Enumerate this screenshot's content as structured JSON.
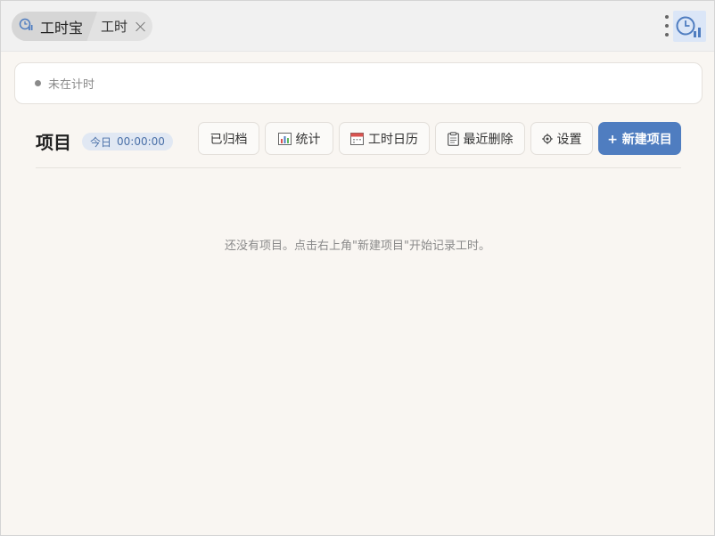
{
  "tabbar": {
    "app_name": "工时宝",
    "sub_tab": "工时"
  },
  "status": {
    "text": "未在计时"
  },
  "projects": {
    "title": "项目",
    "today_label": "今日",
    "today_time": "00:00:00"
  },
  "toolbar": {
    "archived": "已归档",
    "stats": "统计",
    "calendar": "工时日历",
    "recently_deleted": "最近删除",
    "settings": "设置",
    "new_project": "+ 新建项目"
  },
  "empty_state": {
    "message": "还没有项目。点击右上角\"新建项目\"开始记录工时。"
  },
  "colors": {
    "accent": "#4f7dc0",
    "background": "#f9f6f2"
  },
  "icons": {
    "app": "clock-chart-icon",
    "stats": "bar-chart-icon",
    "calendar": "calendar-icon",
    "recently_deleted": "clipboard-icon",
    "settings": "gear-icon",
    "menu": "kebab-menu-icon",
    "close": "close-icon"
  }
}
